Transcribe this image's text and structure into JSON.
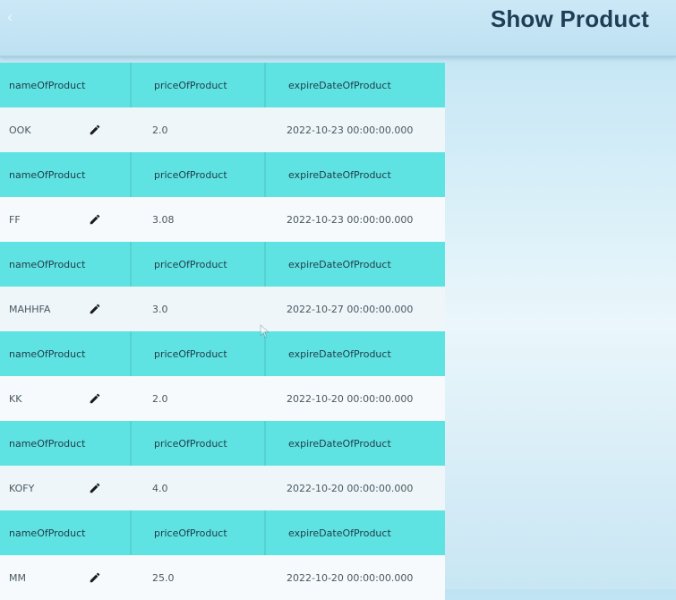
{
  "appbar": {
    "title": "Show Product",
    "back_icon": "back-arrow-icon"
  },
  "products": [
    {
      "headers": [
        "nameOfProduct",
        "priceOfProduct",
        "expireDateOfProduct"
      ],
      "name": "OOK",
      "price": "2.0",
      "expire": "2022-10-23 00:00:00.000"
    },
    {
      "headers": [
        "nameOfProduct",
        "priceOfProduct",
        "expireDateOfProduct"
      ],
      "name": "FF",
      "price": "3.08",
      "expire": "2022-10-23 00:00:00.000"
    },
    {
      "headers": [
        "nameOfProduct",
        "priceOfProduct",
        "expireDateOfProduct"
      ],
      "name": "MAHHFA",
      "price": "3.0",
      "expire": "2022-10-27 00:00:00.000"
    },
    {
      "headers": [
        "nameOfProduct",
        "priceOfProduct",
        "expireDateOfProduct"
      ],
      "name": "KK",
      "price": "2.0",
      "expire": "2022-10-20 00:00:00.000"
    },
    {
      "headers": [
        "nameOfProduct",
        "priceOfProduct",
        "expireDateOfProduct"
      ],
      "name": "KOFY",
      "price": "4.0",
      "expire": "2022-10-20 00:00:00.000"
    },
    {
      "headers": [
        "nameOfProduct",
        "priceOfProduct",
        "expireDateOfProduct"
      ],
      "name": "MM",
      "price": "25.0",
      "expire": "2022-10-20 00:00:00.000"
    }
  ],
  "colors": {
    "header_row": "#5fe3e2",
    "appbar": "#bde1f2",
    "title_text": "#1f3d55"
  }
}
